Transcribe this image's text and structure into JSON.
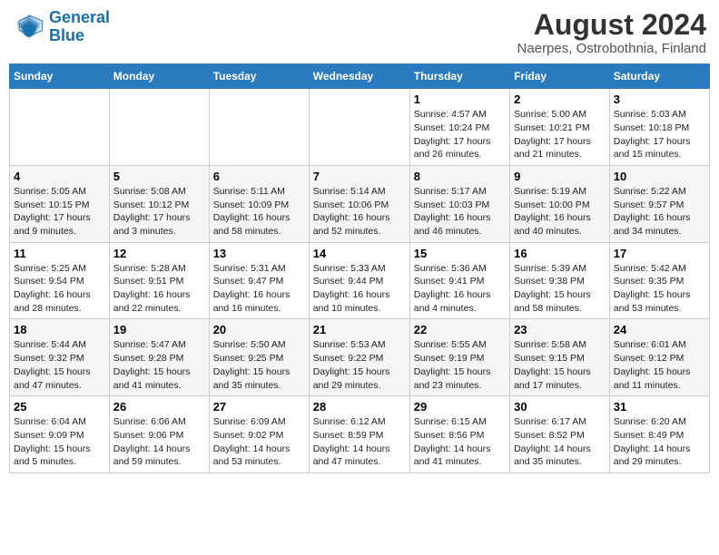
{
  "header": {
    "logo_line1": "General",
    "logo_line2": "Blue",
    "month_year": "August 2024",
    "location": "Naerpes, Ostrobothnia, Finland"
  },
  "days_of_week": [
    "Sunday",
    "Monday",
    "Tuesday",
    "Wednesday",
    "Thursday",
    "Friday",
    "Saturday"
  ],
  "weeks": [
    [
      {
        "day": "",
        "detail": ""
      },
      {
        "day": "",
        "detail": ""
      },
      {
        "day": "",
        "detail": ""
      },
      {
        "day": "",
        "detail": ""
      },
      {
        "day": "1",
        "detail": "Sunrise: 4:57 AM\nSunset: 10:24 PM\nDaylight: 17 hours\nand 26 minutes."
      },
      {
        "day": "2",
        "detail": "Sunrise: 5:00 AM\nSunset: 10:21 PM\nDaylight: 17 hours\nand 21 minutes."
      },
      {
        "day": "3",
        "detail": "Sunrise: 5:03 AM\nSunset: 10:18 PM\nDaylight: 17 hours\nand 15 minutes."
      }
    ],
    [
      {
        "day": "4",
        "detail": "Sunrise: 5:05 AM\nSunset: 10:15 PM\nDaylight: 17 hours\nand 9 minutes."
      },
      {
        "day": "5",
        "detail": "Sunrise: 5:08 AM\nSunset: 10:12 PM\nDaylight: 17 hours\nand 3 minutes."
      },
      {
        "day": "6",
        "detail": "Sunrise: 5:11 AM\nSunset: 10:09 PM\nDaylight: 16 hours\nand 58 minutes."
      },
      {
        "day": "7",
        "detail": "Sunrise: 5:14 AM\nSunset: 10:06 PM\nDaylight: 16 hours\nand 52 minutes."
      },
      {
        "day": "8",
        "detail": "Sunrise: 5:17 AM\nSunset: 10:03 PM\nDaylight: 16 hours\nand 46 minutes."
      },
      {
        "day": "9",
        "detail": "Sunrise: 5:19 AM\nSunset: 10:00 PM\nDaylight: 16 hours\nand 40 minutes."
      },
      {
        "day": "10",
        "detail": "Sunrise: 5:22 AM\nSunset: 9:57 PM\nDaylight: 16 hours\nand 34 minutes."
      }
    ],
    [
      {
        "day": "11",
        "detail": "Sunrise: 5:25 AM\nSunset: 9:54 PM\nDaylight: 16 hours\nand 28 minutes."
      },
      {
        "day": "12",
        "detail": "Sunrise: 5:28 AM\nSunset: 9:51 PM\nDaylight: 16 hours\nand 22 minutes."
      },
      {
        "day": "13",
        "detail": "Sunrise: 5:31 AM\nSunset: 9:47 PM\nDaylight: 16 hours\nand 16 minutes."
      },
      {
        "day": "14",
        "detail": "Sunrise: 5:33 AM\nSunset: 9:44 PM\nDaylight: 16 hours\nand 10 minutes."
      },
      {
        "day": "15",
        "detail": "Sunrise: 5:36 AM\nSunset: 9:41 PM\nDaylight: 16 hours\nand 4 minutes."
      },
      {
        "day": "16",
        "detail": "Sunrise: 5:39 AM\nSunset: 9:38 PM\nDaylight: 15 hours\nand 58 minutes."
      },
      {
        "day": "17",
        "detail": "Sunrise: 5:42 AM\nSunset: 9:35 PM\nDaylight: 15 hours\nand 53 minutes."
      }
    ],
    [
      {
        "day": "18",
        "detail": "Sunrise: 5:44 AM\nSunset: 9:32 PM\nDaylight: 15 hours\nand 47 minutes."
      },
      {
        "day": "19",
        "detail": "Sunrise: 5:47 AM\nSunset: 9:28 PM\nDaylight: 15 hours\nand 41 minutes."
      },
      {
        "day": "20",
        "detail": "Sunrise: 5:50 AM\nSunset: 9:25 PM\nDaylight: 15 hours\nand 35 minutes."
      },
      {
        "day": "21",
        "detail": "Sunrise: 5:53 AM\nSunset: 9:22 PM\nDaylight: 15 hours\nand 29 minutes."
      },
      {
        "day": "22",
        "detail": "Sunrise: 5:55 AM\nSunset: 9:19 PM\nDaylight: 15 hours\nand 23 minutes."
      },
      {
        "day": "23",
        "detail": "Sunrise: 5:58 AM\nSunset: 9:15 PM\nDaylight: 15 hours\nand 17 minutes."
      },
      {
        "day": "24",
        "detail": "Sunrise: 6:01 AM\nSunset: 9:12 PM\nDaylight: 15 hours\nand 11 minutes."
      }
    ],
    [
      {
        "day": "25",
        "detail": "Sunrise: 6:04 AM\nSunset: 9:09 PM\nDaylight: 15 hours\nand 5 minutes."
      },
      {
        "day": "26",
        "detail": "Sunrise: 6:06 AM\nSunset: 9:06 PM\nDaylight: 14 hours\nand 59 minutes."
      },
      {
        "day": "27",
        "detail": "Sunrise: 6:09 AM\nSunset: 9:02 PM\nDaylight: 14 hours\nand 53 minutes."
      },
      {
        "day": "28",
        "detail": "Sunrise: 6:12 AM\nSunset: 8:59 PM\nDaylight: 14 hours\nand 47 minutes."
      },
      {
        "day": "29",
        "detail": "Sunrise: 6:15 AM\nSunset: 8:56 PM\nDaylight: 14 hours\nand 41 minutes."
      },
      {
        "day": "30",
        "detail": "Sunrise: 6:17 AM\nSunset: 8:52 PM\nDaylight: 14 hours\nand 35 minutes."
      },
      {
        "day": "31",
        "detail": "Sunrise: 6:20 AM\nSunset: 8:49 PM\nDaylight: 14 hours\nand 29 minutes."
      }
    ]
  ]
}
